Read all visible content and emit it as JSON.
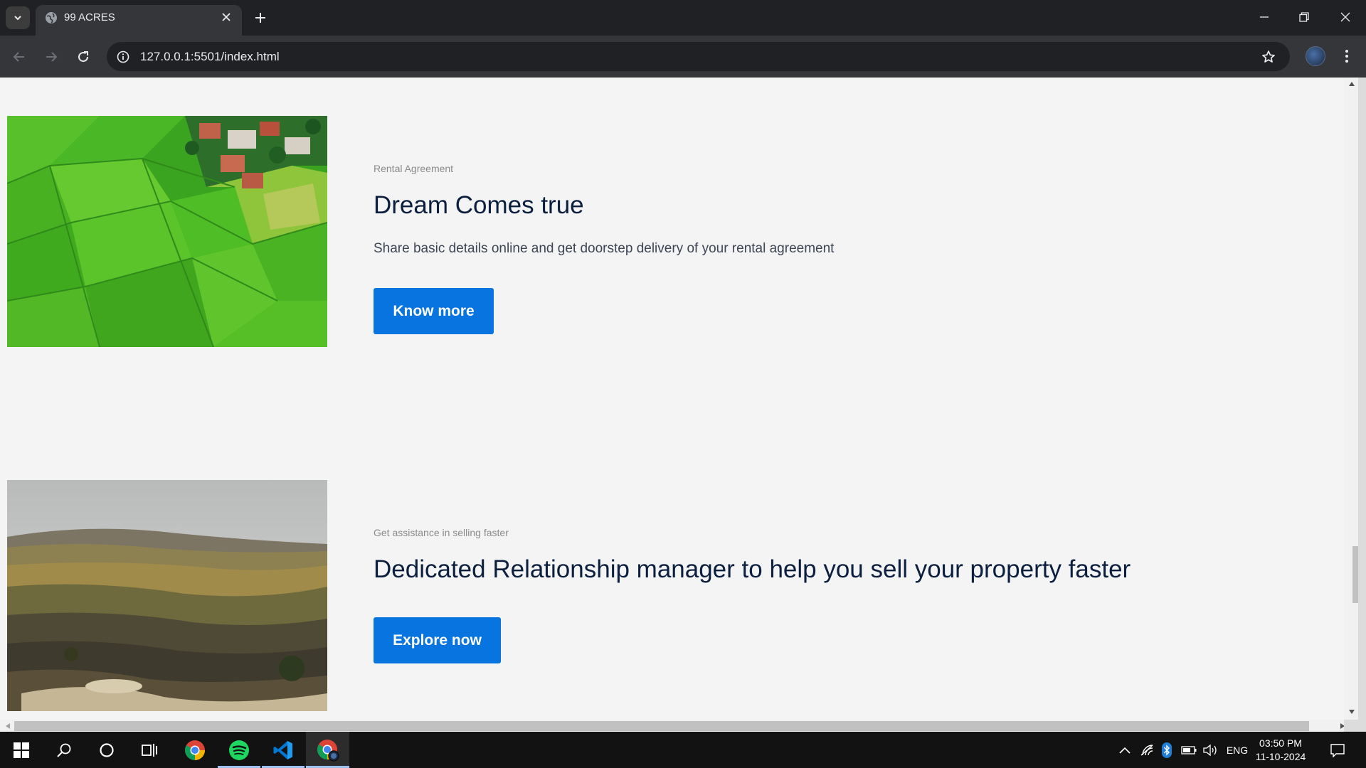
{
  "browser": {
    "tab_title": "99 ACRES",
    "url": "127.0.0.1:5501/index.html"
  },
  "sections": [
    {
      "eyebrow": "Rental Agreement",
      "heading": "Dream Comes true",
      "description": "Share basic details online and get doorstep delivery of your rental agreement",
      "button": "Know more"
    },
    {
      "eyebrow": "Get assistance in selling faster",
      "heading": "Dedicated Relationship manager to help you sell your property faster",
      "button": "Explore now"
    }
  ],
  "taskbar": {
    "language": "ENG",
    "time": "03:50 PM",
    "date": "11-10-2024"
  },
  "colors": {
    "accent": "#0874df",
    "heading": "#0c1f3f",
    "page_bg": "#f4f4f4"
  }
}
